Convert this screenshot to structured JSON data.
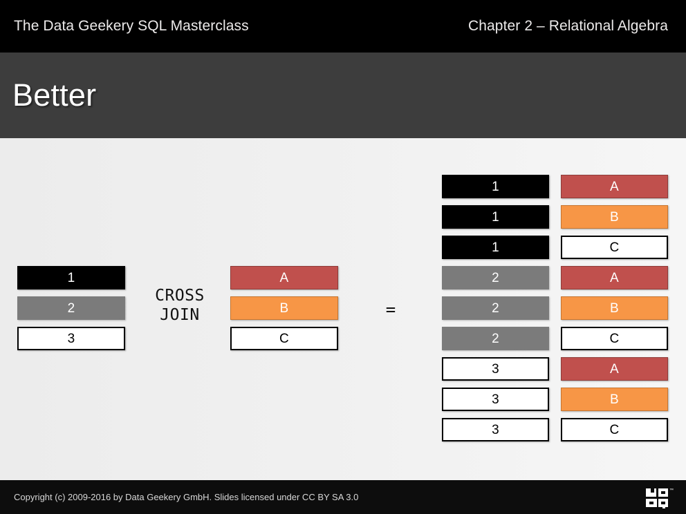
{
  "header": {
    "left_title": "The Data Geekery SQL Masterclass",
    "right_title": "Chapter 2 – Relational Algebra"
  },
  "slide": {
    "title": "Better"
  },
  "diagram": {
    "operator_label": "CROSS\nJOIN",
    "equals_label": "=",
    "left_table": {
      "name": "left-operand-table",
      "rows": [
        {
          "value": "1",
          "style": "black"
        },
        {
          "value": "2",
          "style": "gray"
        },
        {
          "value": "3",
          "style": "white"
        }
      ]
    },
    "right_table": {
      "name": "right-operand-table",
      "rows": [
        {
          "value": "A",
          "style": "red"
        },
        {
          "value": "B",
          "style": "orange"
        },
        {
          "value": "C",
          "style": "white"
        }
      ]
    },
    "result_table": {
      "name": "cross-join-result-table",
      "rows": [
        {
          "left": "1",
          "left_style": "black",
          "right": "A",
          "right_style": "red"
        },
        {
          "left": "1",
          "left_style": "black",
          "right": "B",
          "right_style": "orange"
        },
        {
          "left": "1",
          "left_style": "black",
          "right": "C",
          "right_style": "white"
        },
        {
          "left": "2",
          "left_style": "gray",
          "right": "A",
          "right_style": "red"
        },
        {
          "left": "2",
          "left_style": "gray",
          "right": "B",
          "right_style": "orange"
        },
        {
          "left": "2",
          "left_style": "gray",
          "right": "C",
          "right_style": "white"
        },
        {
          "left": "3",
          "left_style": "white",
          "right": "A",
          "right_style": "red"
        },
        {
          "left": "3",
          "left_style": "white",
          "right": "B",
          "right_style": "orange"
        },
        {
          "left": "3",
          "left_style": "white",
          "right": "C",
          "right_style": "white"
        }
      ]
    }
  },
  "footer": {
    "copyright": "Copyright (c) 2009-2016 by Data Geekery GmbH. Slides licensed under CC BY SA 3.0",
    "logo_name": "jooq-logo",
    "logo_trademark": "™"
  },
  "colors": {
    "topbar_bg": "#000000",
    "title_bg": "#3d3d3d",
    "footer_bg": "#0d0d0d",
    "black_cell": "#000000",
    "gray_cell": "#7b7b7b",
    "white_cell": "#ffffff",
    "red_cell": "#c0504d",
    "orange_cell": "#f79646"
  }
}
